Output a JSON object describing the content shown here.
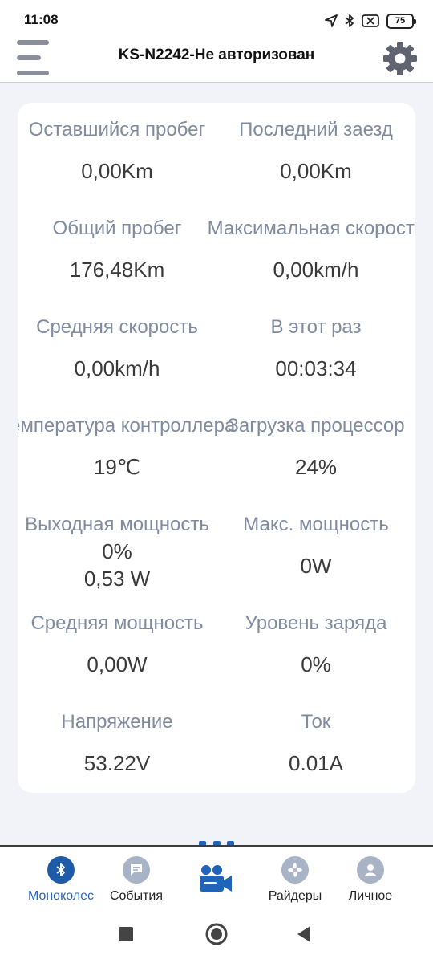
{
  "status_bar": {
    "time": "11:08",
    "battery": "75"
  },
  "header": {
    "title": "KS-N2242-Не авторизован"
  },
  "stats": {
    "remaining_range": {
      "label": "Оставшийся пробег",
      "value": "0,00Km"
    },
    "last_ride": {
      "label": "Последний заезд",
      "value": "0,00Km"
    },
    "total_distance": {
      "label": "Общий пробег",
      "value": "176,48Km"
    },
    "max_speed": {
      "label": "Максимальная скорость",
      "value": "0,00km/h"
    },
    "avg_speed": {
      "label": "Средняя скорость",
      "value": "0,00km/h"
    },
    "this_time": {
      "label": "В этот раз",
      "value": "00:03:34"
    },
    "controller_temp": {
      "label": "Температура контроллера",
      "value": "19℃"
    },
    "cpu_load": {
      "label": "Загрузка процессор",
      "value": "24%"
    },
    "output_power": {
      "label": "Выходная мощность",
      "value_percent": "0%",
      "value_watts": "0,53 W"
    },
    "max_power": {
      "label": "Макс. мощность",
      "value": "0W"
    },
    "avg_power": {
      "label": "Средняя мощность",
      "value": "0,00W"
    },
    "charge_level": {
      "label": "Уровень заряда",
      "value": "0%"
    },
    "voltage": {
      "label": "Напряжение",
      "value": "53.22V"
    },
    "current": {
      "label": "Ток",
      "value": "0.01A"
    }
  },
  "bottom_nav": {
    "items": [
      {
        "label": "Моноколес",
        "icon": "bluetooth-icon",
        "active": true
      },
      {
        "label": "События",
        "icon": "chat-icon",
        "active": false
      },
      {
        "label": "Райдеры",
        "icon": "fan-icon",
        "active": false
      },
      {
        "label": "Личное",
        "icon": "person-icon",
        "active": false
      }
    ],
    "center_icon": "camera-icon"
  },
  "colors": {
    "accent": "#1d5ba8",
    "label": "#7f8b9f",
    "value": "#3a3a3a",
    "background": "#f1f3f8"
  }
}
